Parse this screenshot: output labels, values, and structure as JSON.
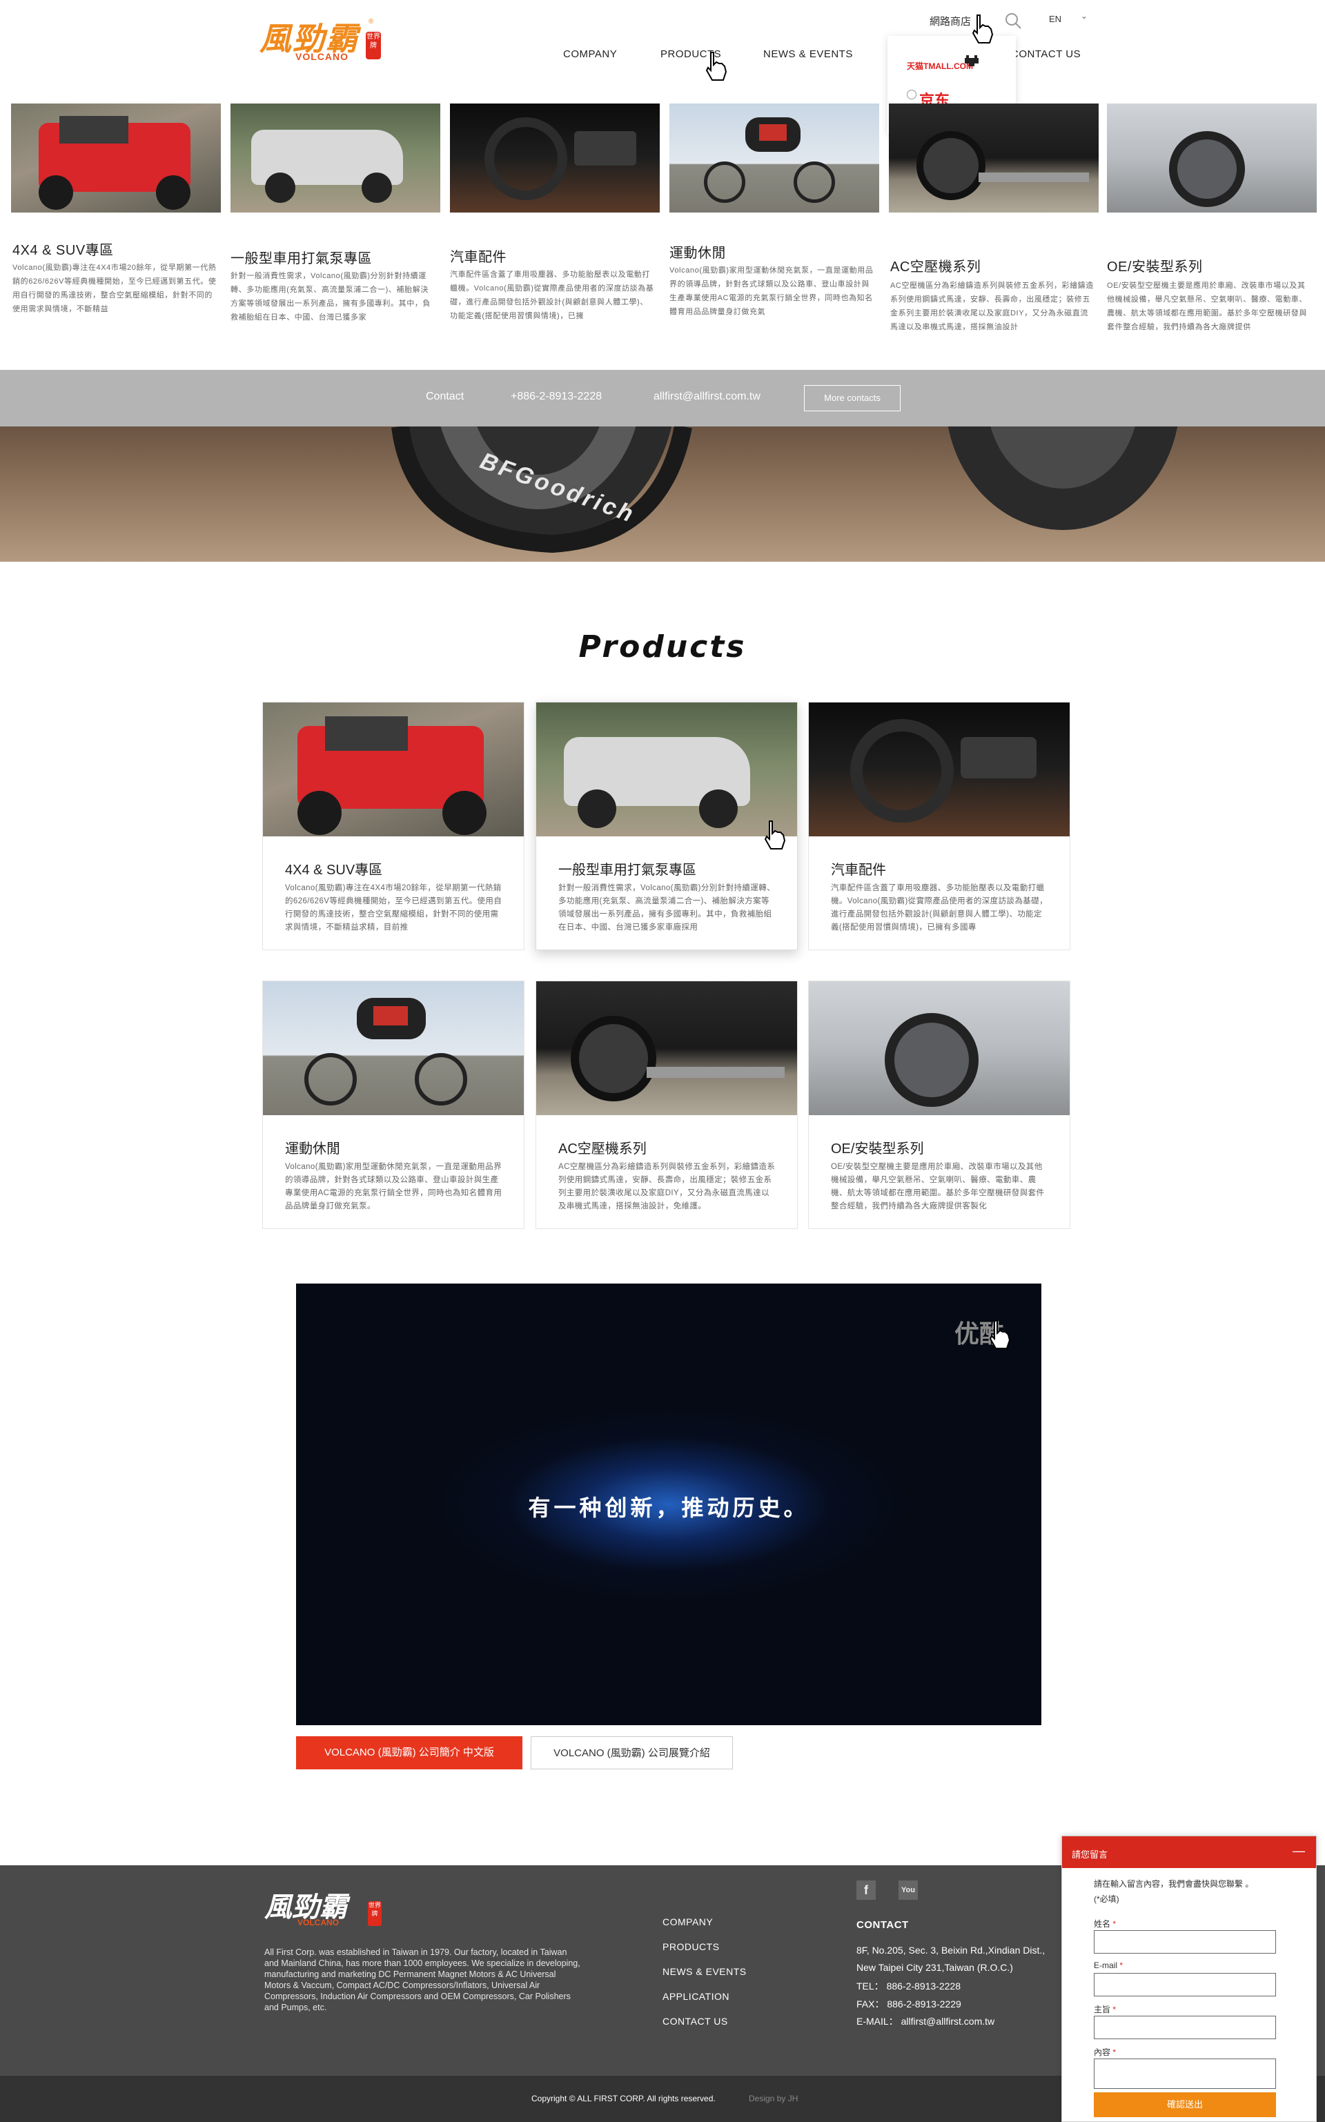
{
  "brand": {
    "logo_cn": "風勁霸",
    "logo_en": "VOLCANO",
    "logo_badge": "世界牌"
  },
  "header": {
    "online_store": "網路商店",
    "language": "EN",
    "nav": [
      "COMPANY",
      "PRODUCTS",
      "NEWS & EVENTS",
      "CONTACT US"
    ],
    "store_dropdown": [
      "天猫TMALL.COM",
      "京东"
    ]
  },
  "strip": [
    {
      "title": "4X4 & SUV專區",
      "desc": "Volcano(風勁霸)專注在4X4市場20餘年，從早期第一代熱銷的626/626V等經典機種開始，至今已經邁到第五代。使用自行開發的馬達技術，整合空氣壓縮模組，針對不同的使用需求與情境，不斷精益"
    },
    {
      "title": "一般型車用打氣泵專區",
      "desc": "針對一般消費性需求，Volcano(風勁霸)分別針對持續運轉、多功能應用(充氣泵、高流量泵浦二合一)、補胎解決方案等領域發展出一系列產品，擁有多國專利。其中，負救補胎組在日本、中國、台灣已獲多家"
    },
    {
      "title": "汽車配件",
      "desc": "汽車配件區含蓋了車用吸塵器、多功能胎壓表以及電動打蠟機。Volcano(風勁霸)從實際產品使用者的深度訪談為基礎，進行產品開發包括外觀設計(與顧創意與人體工學)、功能定義(搭配使用習慣與情境)，已擁"
    },
    {
      "title": "運動休閒",
      "desc": "Volcano(風勁霸)家用型運動休閒充氣泵，一直是運動用品界的領導品牌，針對各式球類以及公路車、登山車設計與生產專業使用AC電源的充氣泵行銷全世界，同時也為知名體育用品品牌量身訂做充氣"
    },
    {
      "title": "AC空壓機系列",
      "desc": "AC空壓機區分為彩繪鑄造系列與裝修五金系列，彩繪鑄造系列使用鋼鑄式馬達，安靜、長壽命，出風穩定；裝修五金系列主要用於裝潢收尾以及家庭DIY，又分為永磁直流馬達以及串機式馬達，搭採無油設計"
    },
    {
      "title": "OE/安裝型系列",
      "desc": "OE/安裝型空壓機主要是應用於車廂、改裝車市場以及其他機械設備，舉凡空氣懸吊、空氣喇叭、醫療、電動車、農機、航太等領域都在應用範圍。基於多年空壓機研發與套件整合經驗，我們持續為各大廠牌提供"
    }
  ],
  "contact_bar": {
    "label": "Contact",
    "phone": "+886-2-8913-2228",
    "email": "allfirst@allfirst.com.tw",
    "button": "More contacts"
  },
  "tire_text": "BFGoodrich",
  "products": {
    "title": "Products",
    "cards": [
      {
        "title": "4X4 & SUV專區",
        "desc": "Volcano(風勁霸)專注在4X4市場20餘年，從早期第一代熱銷的626/626V等經典機種開始，至今已經邁到第五代。使用自行開發的馬達技術，整合空氣壓縮模組，針對不同的使用需求與情境，不斷精益求精，目前推"
      },
      {
        "title": "一般型車用打氣泵專區",
        "desc": "針對一般消費性需求，Volcano(風勁霸)分別針對持續運轉、多功能應用(充氣泵、高流量泵浦二合一)、補胎解決方案等領域發展出一系列產品，擁有多國專利。其中，負救補胎組在日本、中國、台灣已獲多家車廠採用"
      },
      {
        "title": "汽車配件",
        "desc": "汽車配件區含蓋了車用吸塵器、多功能胎壓表以及電動打蠟機。Volcano(風勁霸)從實際產品使用者的深度訪談為基礎，進行產品開發包括外觀設計(與顧創意與人體工學)、功能定義(搭配使用習慣與情境)，已擁有多國專"
      },
      {
        "title": "運動休閒",
        "desc": "Volcano(風勁霸)家用型運動休閒充氣泵，一直是運動用品界的領導品牌，針對各式球類以及公路車、登山車設計與生產專業使用AC電源的充氣泵行銷全世界，同時也為知名體育用品品牌量身訂做充氣泵。"
      },
      {
        "title": "AC空壓機系列",
        "desc": "AC空壓機區分為彩繪鑄造系列與裝修五金系列，彩繪鑄造系列使用鋼鑄式馬達，安靜、長壽命，出風穩定；裝修五金系列主要用於裝潢收尾以及家庭DIY，又分為永磁直流馬達以及串機式馬達，搭採無油設計，免維護。"
      },
      {
        "title": "OE/安裝型系列",
        "desc": "OE/安裝型空壓機主要是應用於車廂、改裝車市場以及其他機械設備，舉凡空氣懸吊、空氣喇叭、醫療、電動車、農機、航太等領域都在應用範圍。基於多年空壓機研發與套件整合經驗，我們持續為各大廠牌提供客製化"
      }
    ]
  },
  "video": {
    "caption": "有一种创新，推动历史。",
    "corner_logo": "优酷",
    "buttons": [
      "VOLCANO (風勁霸) 公司簡介 中文版",
      "VOLCANO (風勁霸) 公司展覽介紹"
    ]
  },
  "footer": {
    "about": "All First Corp. was established in Taiwan in 1979. Our factory, located in Taiwan and Mainland China, has more than 1000 employees. We specialize in developing, manufacturing and marketing DC Permanent Magnet Motors & AC Universal Motors & Vaccum, Compact AC/DC Compressors/Inflators, Universal Air Compressors, Induction Air Compressors and OEM Compressors, Car Polishers and Pumps, etc.",
    "links": [
      "COMPANY",
      "PRODUCTS",
      "NEWS & EVENTS",
      "APPLICATION",
      "CONTACT US"
    ],
    "contact_title": "CONTACT",
    "contact_lines": [
      "8F, No.205, Sec. 3, Beixin Rd.,Xindian Dist.,",
      "New Taipei City 231,Taiwan (R.O.C.)",
      "TEL： 886-2-8913-2228",
      "FAX： 886-2-8913-2229",
      "E-MAIL： allfirst@allfirst.com.tw"
    ],
    "social": [
      "facebook-icon",
      "youtube-icon"
    ],
    "copyright": "Copyright © ALL FIRST CORP. All rights reserved.",
    "design": "Design by JH"
  },
  "message_panel": {
    "title": "請您留言",
    "minimize": "—",
    "intro": "請在輸入留言內容，我們會盡快與您聯繫 。",
    "required_note": "(*必填)",
    "fields": [
      "姓名",
      "E-mail",
      "主旨",
      "內容"
    ],
    "required_mark": "*",
    "submit": "確認送出"
  },
  "colors": {
    "accent_red": "#d6281c",
    "logo_orange": "#f08a1c",
    "submit_orange": "#f08a12",
    "footer_bg": "#4a4a4a",
    "contact_bar": "#b4b4b4"
  }
}
